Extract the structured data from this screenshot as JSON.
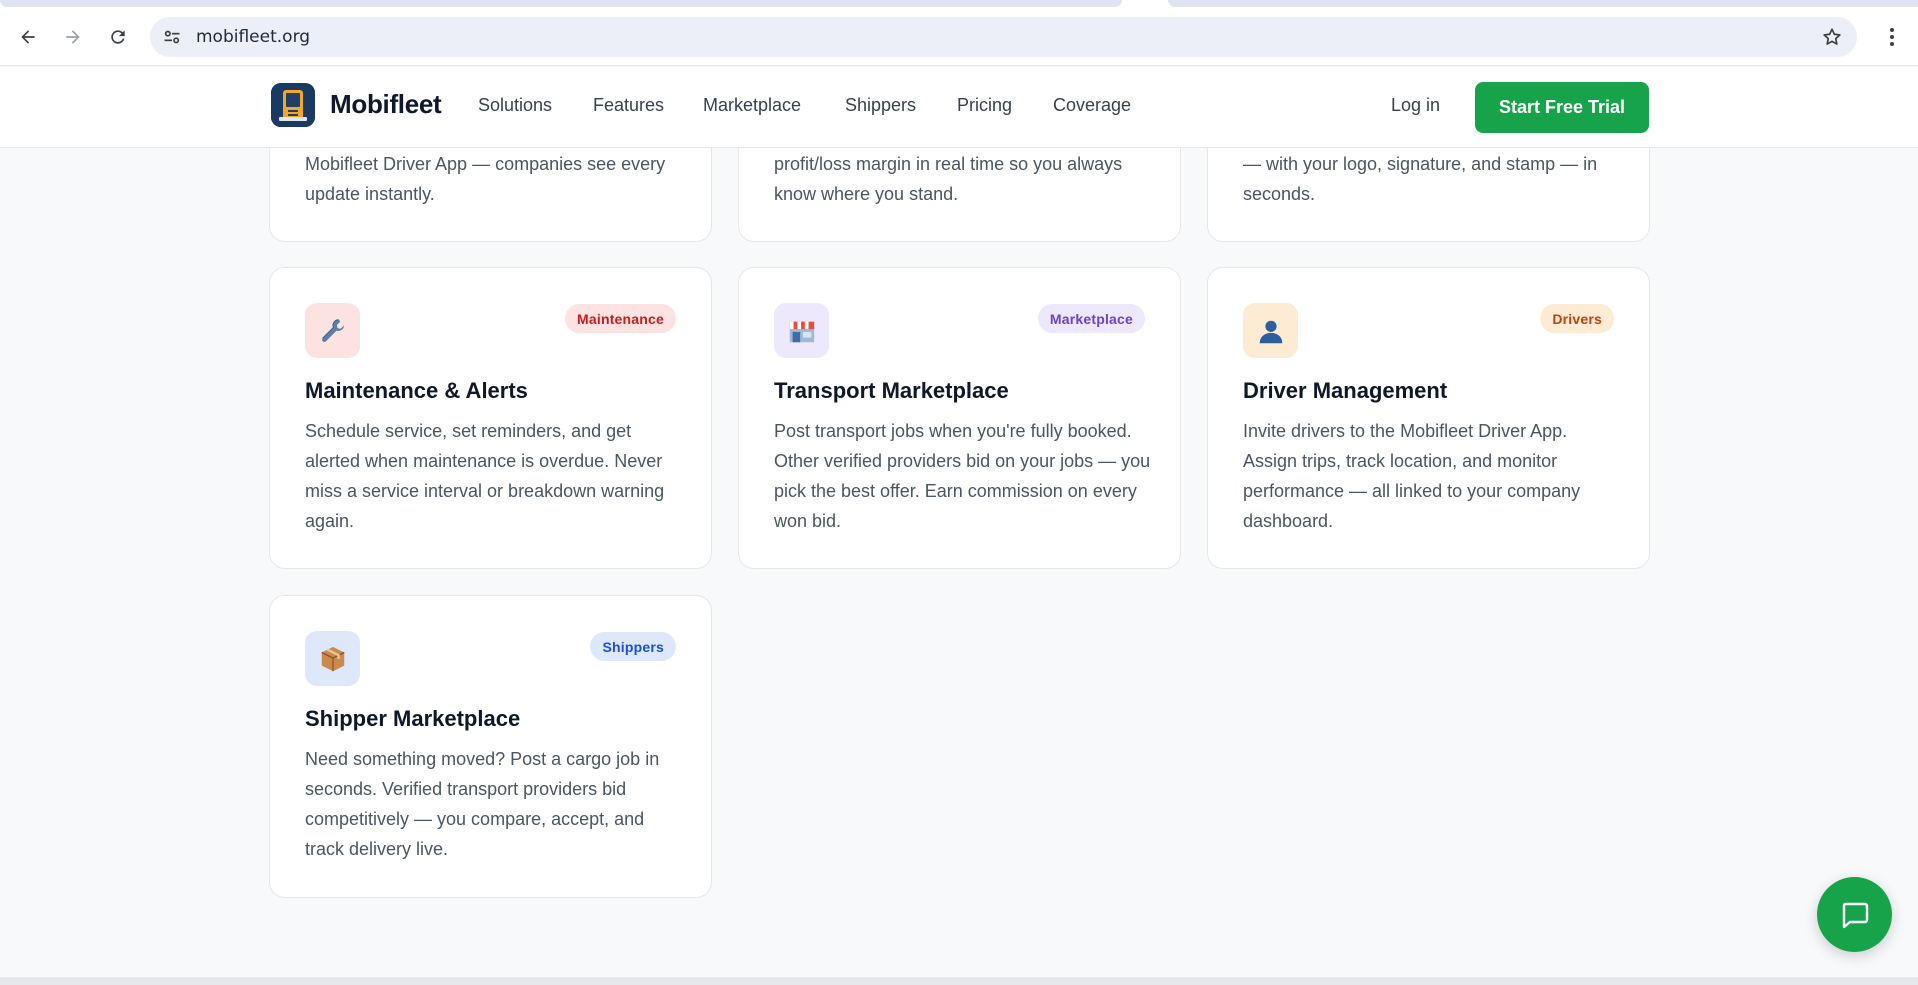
{
  "browser": {
    "url": "mobifleet.org"
  },
  "header": {
    "brand": "Mobifleet",
    "nav": [
      "Solutions",
      "Features",
      "Marketplace",
      "Shippers",
      "Pricing",
      "Coverage"
    ],
    "login_label": "Log in",
    "cta_label": "Start Free Trial"
  },
  "top_cards": [
    {
      "desc": "Mobifleet Driver App — companies see every update instantly."
    },
    {
      "desc": "profit/loss margin in real time so you always know where you stand."
    },
    {
      "desc": "— with your logo, signature, and stamp — in seconds."
    }
  ],
  "cards": [
    {
      "tag": "Maintenance",
      "title": "Maintenance & Alerts",
      "desc": "Schedule service, set reminders, and get alerted when maintenance is overdue. Never miss a service interval or breakdown warning again.",
      "icon": "wrench-icon",
      "tile_color": "#fde2e2",
      "tag_bg": "#fde2e2",
      "tag_color": "#c81e1e"
    },
    {
      "tag": "Marketplace",
      "title": "Transport Marketplace",
      "desc": "Post transport jobs when you're fully booked. Other verified providers bid on your jobs — you pick the best offer. Earn commission on every won bid.",
      "icon": "store-icon",
      "tile_color": "#ede8fb",
      "tag_bg": "#ede8fb",
      "tag_color": "#6d3fd6"
    },
    {
      "tag": "Drivers",
      "title": "Driver Management",
      "desc": "Invite drivers to the Mobifleet Driver App. Assign trips, track location, and monitor performance — all linked to your company dashboard.",
      "icon": "person-icon",
      "tile_color": "#fdebd3",
      "tag_bg": "#fdebd3",
      "tag_color": "#c2410c"
    },
    {
      "tag": "Shippers",
      "title": "Shipper Marketplace",
      "desc": "Need something moved? Post a cargo job in seconds. Verified transport providers bid competitively — you compare, accept, and track delivery live.",
      "icon": "package-icon",
      "tile_color": "#dde9fb",
      "tag_bg": "#dde9fb",
      "tag_color": "#1d4ed8"
    }
  ],
  "colors": {
    "accent": "#16a34a",
    "page_bg": "#f8f9fb"
  }
}
